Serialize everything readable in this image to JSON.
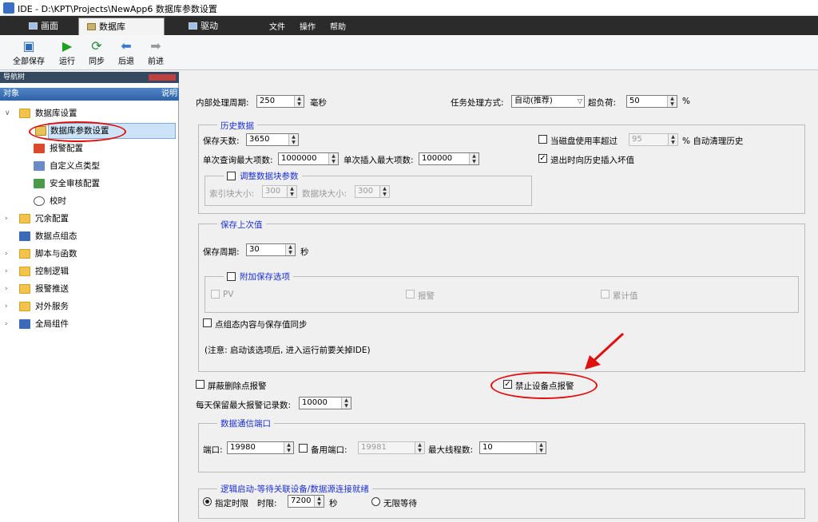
{
  "window": {
    "title": "IDE - D:\\KPT\\Projects\\NewApp6  数据库参数设置"
  },
  "menubar": {
    "tabs": [
      "画面",
      "数据库",
      "驱动"
    ],
    "menus": [
      "文件",
      "操作",
      "帮助"
    ]
  },
  "toolbar": {
    "buttons": [
      "全部保存",
      "运行",
      "同步",
      "后退",
      "前进"
    ]
  },
  "nav": {
    "title": "导航树",
    "header": "对象",
    "header_right": "说明",
    "items": [
      "数据库设置",
      "数据库参数设置",
      "报警配置",
      "自定义点类型",
      "安全审核配置",
      "校时",
      "冗余配置",
      "数据点组态",
      "脚本与函数",
      "控制逻辑",
      "报警推送",
      "对外服务",
      "全局组件"
    ]
  },
  "form": {
    "cycle_label": "内部处理周期:",
    "cycle_value": "250",
    "cycle_unit": "毫秒",
    "task_label": "任务处理方式:",
    "task_value": "自动(推荐)",
    "overload_label": "超负荷:",
    "overload_value": "50",
    "overload_unit": "%",
    "history": {
      "title": "历史数据",
      "days_label": "保存天数:",
      "days_value": "3650",
      "disk_label": "当磁盘使用率超过",
      "disk_value": "95",
      "disk_unit": "% 自动清理历史",
      "max_query_label": "单次查询最大项数:",
      "max_query_value": "1000000",
      "max_insert_label": "单次插入最大项数:",
      "max_insert_value": "100000",
      "exit_label": "退出时向历史插入坏值",
      "block_title": "调整数据块参数",
      "index_block_label": "索引块大小:",
      "index_block_value": "300",
      "data_block_label": "数据块大小:",
      "data_block_value": "300"
    },
    "lastval": {
      "title": "保存上次值",
      "period_label": "保存周期:",
      "period_value": "30",
      "period_unit": "秒",
      "extra_title": "附加保存选项",
      "opt_pv": "PV",
      "opt_alarm": "报警",
      "opt_acc": "累计值",
      "sync_label": "点组态内容与保存值同步",
      "note": "(注意: 启动该选项后, 进入运行前要关掉IDE)"
    },
    "mask_delete_label": "屏蔽删除点报警",
    "disable_device_label": "禁止设备点报警",
    "daily_max_label": "每天保留最大报警记录数:",
    "daily_max_value": "10000",
    "comm": {
      "title": "数据通信端口",
      "port_label": "端口:",
      "port_value": "19980",
      "backup_label": "备用端口:",
      "backup_value": "19981",
      "threads_label": "最大线程数:",
      "threads_value": "10"
    },
    "logic": {
      "title": "逻辑启动-等待关联设备/数据源连接就绪",
      "fixed_label": "指定时限",
      "time_label": "时限:",
      "time_value": "7200",
      "time_unit": "秒",
      "infinite_label": "无限等待"
    }
  },
  "colors": {
    "annotation": "#e01010",
    "group_title": "#1a2fd0"
  }
}
